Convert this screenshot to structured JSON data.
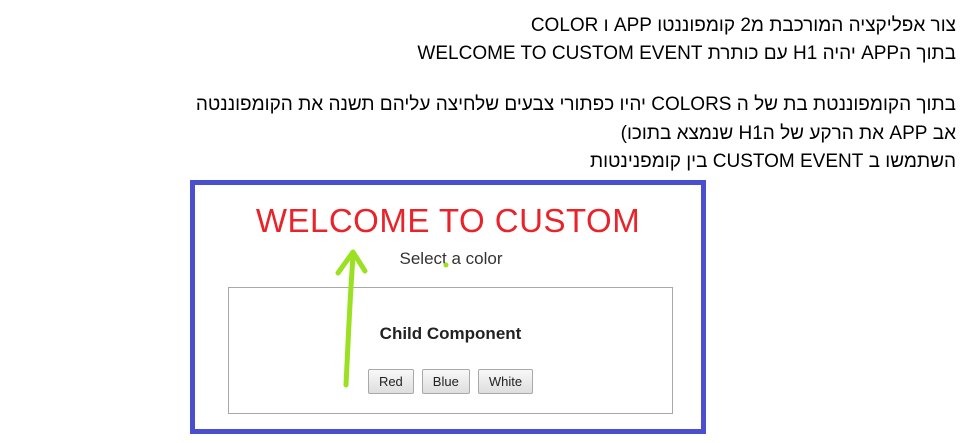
{
  "doc": {
    "lines": [
      "צור אפליקציה המורכבת מ2 קומפוננטו APP ו COLOR",
      "בתוך הAPP יהיה H1 עם כותרת WELCOME TO CUSTOM EVENT",
      "בתוך הקומפוננטת בת של ה COLORS יהיו כפתורי צבעים שלחיצה עליהם תשנה את הקומפוננטה",
      "אב  APP את הרקע של הH1 שנמצא בתוכו)",
      "השתמשו ב CUSTOM EVENT בין קומפנינטות"
    ]
  },
  "preview": {
    "title": "WELCOME TO CUSTOM",
    "subtitle": "Select a color",
    "child": {
      "title": "Child Component",
      "buttons": [
        "Red",
        "Blue",
        "White"
      ]
    }
  },
  "colors": {
    "frame_border": "#4a4fd0",
    "title": "#e8232a",
    "arrow": "#9be021"
  }
}
